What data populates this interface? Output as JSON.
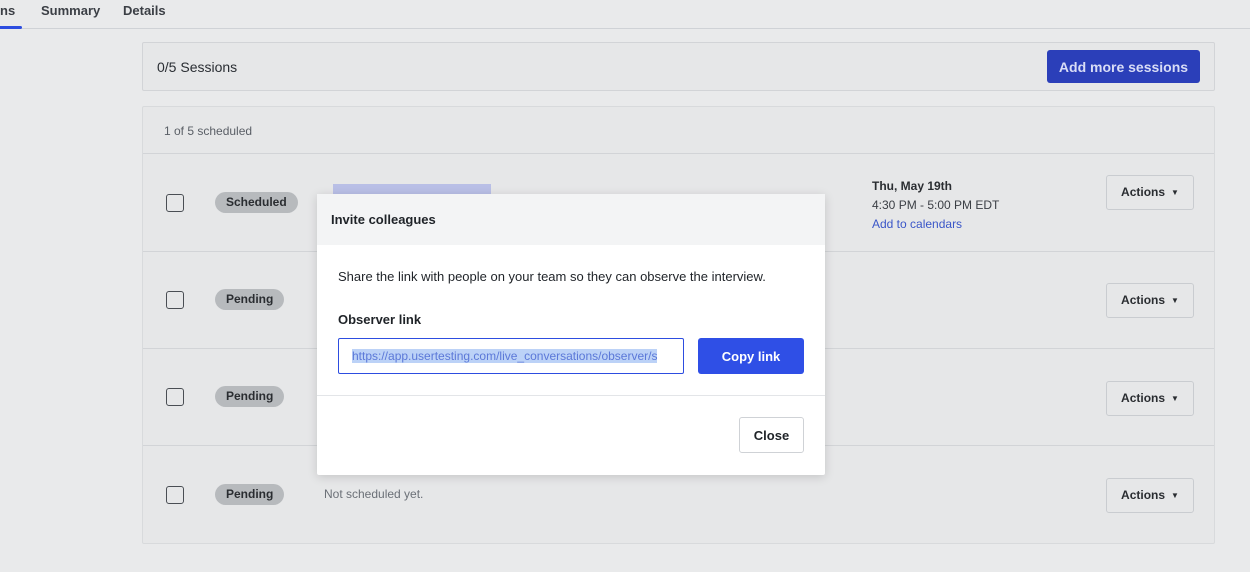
{
  "tabs": [
    {
      "label": "ns"
    },
    {
      "label": "Summary"
    },
    {
      "label": "Details"
    }
  ],
  "sessions_header": {
    "count": "0/5 Sessions",
    "add_button": "Add more sessions"
  },
  "list": {
    "scheduled_count": "1 of 5 scheduled",
    "rows": [
      {
        "status": "Scheduled",
        "date": "Thu, May 19th",
        "time": "4:30 PM - 5:00 PM EDT",
        "calendar_link": "Add to calendars",
        "actions": "Actions"
      },
      {
        "status": "Pending",
        "actions": "Actions"
      },
      {
        "status": "Pending",
        "actions": "Actions"
      },
      {
        "status": "Pending",
        "note": "Not scheduled yet.",
        "actions": "Actions"
      }
    ]
  },
  "modal": {
    "title": "Invite colleagues",
    "description": "Share the link with people on your team so they can observe the interview.",
    "observer_label": "Observer link",
    "observer_url": "https://app.usertesting.com/live_conversations/observer/s",
    "copy_button": "Copy link",
    "close_button": "Close"
  },
  "colors": {
    "accent": "#2f4fe6",
    "overlay_bg": "#e9eaeb"
  }
}
